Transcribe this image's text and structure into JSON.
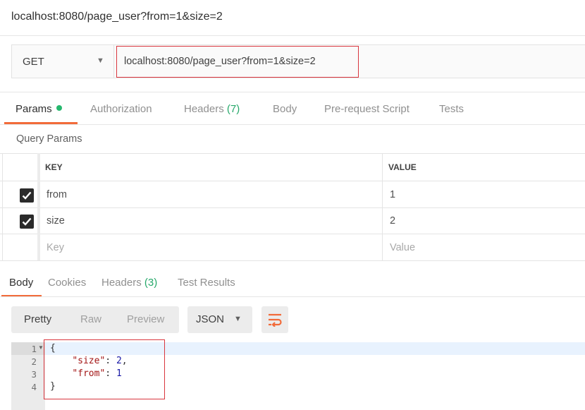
{
  "window": {
    "title": "localhost:8080/page_user?from=1&size=2"
  },
  "request": {
    "method": "GET",
    "url": "localhost:8080/page_user?from=1&size=2"
  },
  "request_tabs": {
    "params": "Params",
    "authorization": "Authorization",
    "headers": "Headers",
    "headers_count": "(7)",
    "body": "Body",
    "prerequest": "Pre-request Script",
    "tests": "Tests"
  },
  "query_params": {
    "section_label": "Query Params",
    "columns": {
      "key": "KEY",
      "value": "VALUE"
    },
    "rows": [
      {
        "checked": true,
        "key": "from",
        "value": "1"
      },
      {
        "checked": true,
        "key": "size",
        "value": "2"
      }
    ],
    "placeholder_key": "Key",
    "placeholder_value": "Value"
  },
  "response_tabs": {
    "body": "Body",
    "cookies": "Cookies",
    "headers": "Headers",
    "headers_count": "(3)",
    "test_results": "Test Results"
  },
  "view_modes": {
    "pretty": "Pretty",
    "raw": "Raw",
    "preview": "Preview",
    "format": "JSON"
  },
  "response_body": {
    "line_numbers": [
      "1",
      "2",
      "3",
      "4"
    ],
    "open_brace": "{",
    "size_key": "\"size\"",
    "size_value": "2",
    "from_key": "\"from\"",
    "from_value": "1",
    "close_brace": "}"
  },
  "colors": {
    "accent": "#f26b3a",
    "status_dot": "#26b86e",
    "highlight_outline": "#d9363e"
  },
  "icons": {
    "method_caret": "chevron-down-icon",
    "format_caret": "chevron-down-icon",
    "wrap": "wrap-lines-icon",
    "checkbox": "checkmark-icon",
    "fold": "fold-arrow-icon"
  }
}
